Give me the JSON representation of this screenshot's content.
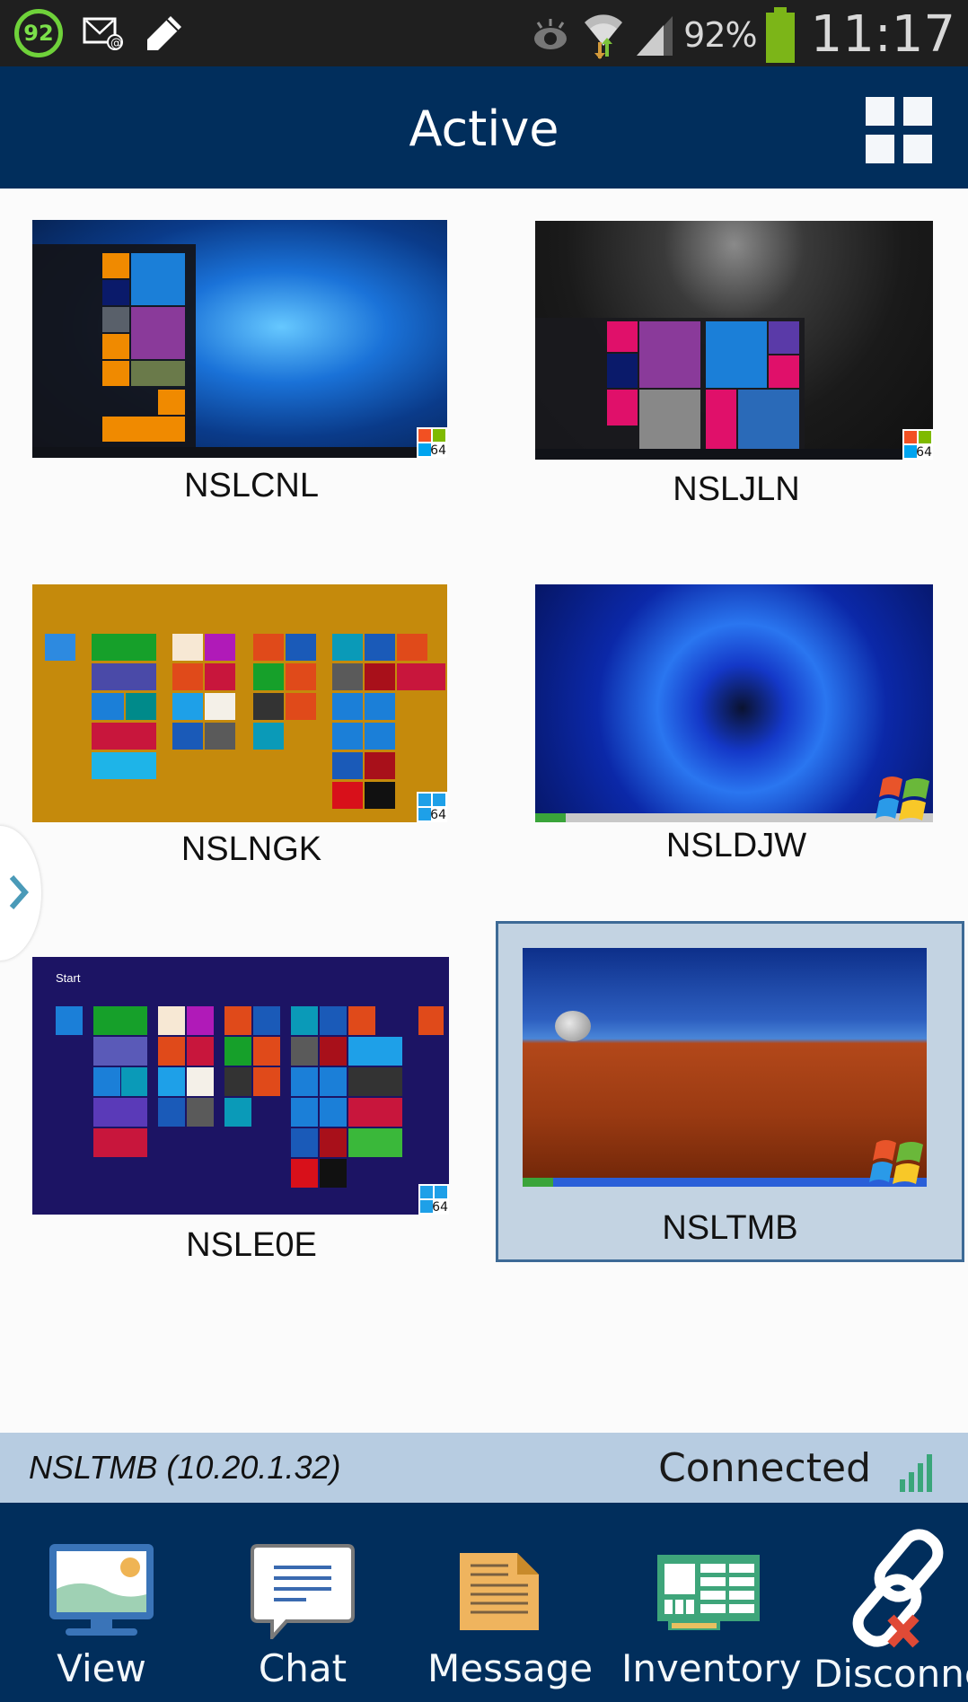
{
  "status_bar": {
    "notification_badge": "92",
    "left_icons": [
      "score-badge-icon",
      "email-icon",
      "pen-icon"
    ],
    "right_icons": [
      "eye-icon",
      "wifi-icon",
      "cellular-signal-icon"
    ],
    "battery_percent": "92%",
    "battery_level": 0.92,
    "time": "11:17"
  },
  "app_bar": {
    "title": "Active",
    "grid_view_icon": "grid-icon"
  },
  "computers": [
    {
      "name": "NSLCNL",
      "os": "windows-10",
      "arch_badge": "64",
      "selected": false
    },
    {
      "name": "NSLJLN",
      "os": "windows-10",
      "arch_badge": "64",
      "selected": false
    },
    {
      "name": "NSLNGK",
      "os": "windows-8",
      "arch_badge": "64",
      "selected": false
    },
    {
      "name": "NSLDJW",
      "os": "windows-xp",
      "arch_badge": "",
      "selected": false
    },
    {
      "name": "NSLE0E",
      "os": "windows-8",
      "arch_badge": "64",
      "selected": false
    },
    {
      "name": "NSLTMB",
      "os": "windows-xp",
      "arch_badge": "",
      "selected": true
    }
  ],
  "side_drawer": {
    "icon": "chevron-right-icon"
  },
  "connection": {
    "target": "NSLTMB (10.20.1.32)",
    "status": "Connected",
    "signal_bars": 4,
    "colors": {
      "signal": "#3aa67a"
    }
  },
  "bottom_nav": [
    {
      "label": "View",
      "icon": "monitor-icon"
    },
    {
      "label": "Chat",
      "icon": "chat-bubble-icon"
    },
    {
      "label": "Message",
      "icon": "document-icon"
    },
    {
      "label": "Inventory",
      "icon": "circuit-board-icon"
    },
    {
      "label": "Disconne",
      "icon": "broken-link-icon"
    }
  ],
  "colors": {
    "primary": "#012e5c",
    "status_strip": "#b7cce1",
    "selected_tile": "#c3d3e2",
    "selected_border": "#3d6a96"
  }
}
